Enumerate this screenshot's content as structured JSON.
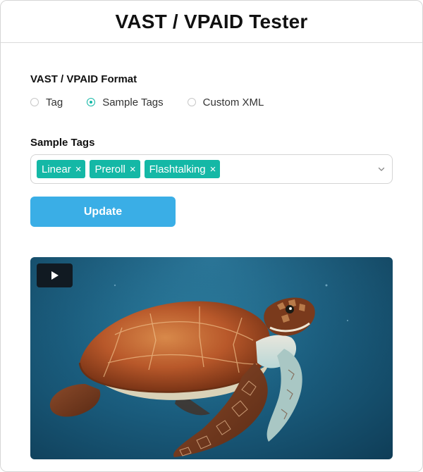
{
  "app": {
    "title": "VAST / VPAID Tester"
  },
  "format": {
    "label": "VAST / VPAID Format",
    "options": [
      {
        "label": "Tag",
        "selected": false
      },
      {
        "label": "Sample Tags",
        "selected": true
      },
      {
        "label": "Custom XML",
        "selected": false
      }
    ]
  },
  "sample_tags": {
    "label": "Sample Tags",
    "chips": [
      "Linear",
      "Preroll",
      "Flashtalking"
    ],
    "remove_symbol": "×",
    "dropdown_icon": "chevron-down-icon"
  },
  "actions": {
    "update_label": "Update"
  },
  "video": {
    "play_icon": "play-icon",
    "subject": "sea turtle swimming"
  },
  "colors": {
    "accent": "#14b8a6",
    "button": "#3aaee6",
    "play_button_bg": "#111a22"
  }
}
